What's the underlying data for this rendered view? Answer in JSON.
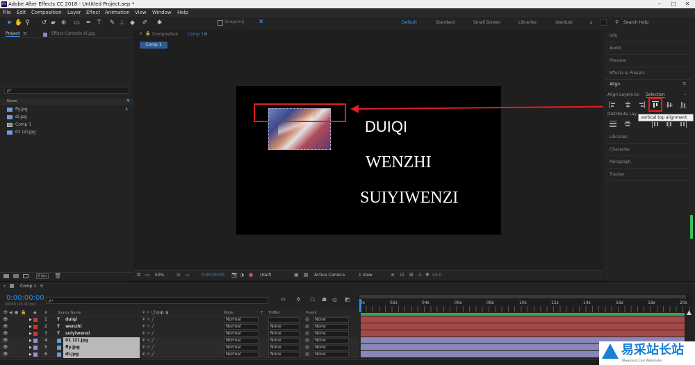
{
  "window": {
    "title": "Adobe After Effects CC 2018 - Untitled Project.aep *",
    "logo": "Ae",
    "minimize": "–",
    "maximize": "□",
    "close": "✕"
  },
  "menu": [
    "File",
    "Edit",
    "Composition",
    "Layer",
    "Effect",
    "Animation",
    "View",
    "Window",
    "Help"
  ],
  "toolbar": {
    "snapping": "Snapping",
    "workspaces": [
      "Default",
      "Standard",
      "Small Screen",
      "Libraries",
      "stardust"
    ],
    "overflow": "»",
    "search": "Search Help"
  },
  "project": {
    "tab": "Project",
    "effect_controls_tab": "Effect Controls di.jpg",
    "search_placeholder": "ρ•",
    "name_col": "Name",
    "items": [
      {
        "icon": "image",
        "name": "fly.jpg"
      },
      {
        "icon": "image",
        "name": "di.jpg"
      },
      {
        "icon": "comp",
        "name": "Comp 1"
      },
      {
        "icon": "image",
        "name": "01 (2).jpg"
      }
    ],
    "bpc": "8 bpc"
  },
  "composition": {
    "tab_prefix": "Composition",
    "tab_name": "Comp 1",
    "sub_tab": "Comp 1",
    "zoom": "50%",
    "timecode": "0:00:00:00",
    "resolution": "(Half)",
    "camera": "Active Camera",
    "views": "1 View",
    "offset": "+0.0",
    "texts": [
      "DUIQI",
      "WENZHI",
      "SUIYIWENZI"
    ]
  },
  "right_panel": {
    "items_top": [
      "Info",
      "Audio",
      "Preview",
      "Effects & Presets"
    ],
    "align_title": "Align",
    "align_layers_to_label": "Align Layers to:",
    "align_layers_to_value": "Selection",
    "distribute_label": "Distribute Lay",
    "tooltip": "vertical top alignment",
    "items_bottom": [
      "Libraries",
      "Character",
      "Paragraph",
      "Tracker"
    ]
  },
  "timeline": {
    "tab": "Comp 1",
    "timecode": "0:00:00:00",
    "frames": "00000 (25.00 fps)",
    "search_placeholder": "ρ•",
    "col_hash": "#",
    "col_source": "Source Name",
    "col_mode": "Mode",
    "col_t": "T",
    "col_trkmat": "TrkMat",
    "col_parent": "Parent",
    "ruler": [
      "0s",
      "02s",
      "04s",
      "06s",
      "08s",
      "10s",
      "12s",
      "14s",
      "16s",
      "18s",
      "20s"
    ],
    "layers": [
      {
        "num": "1",
        "type": "T",
        "name": "duiqi",
        "mode": "Normal",
        "trkmat": "",
        "parent": "None",
        "label_color": "#c23a3a",
        "bar_color": "#a44a4a"
      },
      {
        "num": "2",
        "type": "T",
        "name": "wenzhi",
        "mode": "Normal",
        "trkmat": "None",
        "parent": "None",
        "label_color": "#c23a3a",
        "bar_color": "#a44a4a"
      },
      {
        "num": "3",
        "type": "T",
        "name": "suiyiwenzi",
        "mode": "Normal",
        "trkmat": "None",
        "parent": "None",
        "label_color": "#c23a3a",
        "bar_color": "#a44a4a"
      },
      {
        "num": "4",
        "type": "img",
        "name": "01 (2).jpg",
        "mode": "Normal",
        "trkmat": "None",
        "parent": "None",
        "label_color": "#9a8fc8",
        "bar_color": "#8a86b8"
      },
      {
        "num": "5",
        "type": "img",
        "name": "fly.jpg",
        "mode": "Normal",
        "trkmat": "None",
        "parent": "None",
        "label_color": "#9a8fc8",
        "bar_color": "#8a86b8"
      },
      {
        "num": "6",
        "type": "img",
        "name": "di.jpg",
        "mode": "Normal",
        "trkmat": "None",
        "parent": "None",
        "label_color": "#9a8fc8",
        "bar_color": "#8a86b8"
      }
    ]
  },
  "watermark": {
    "text": "易采站长站",
    "sub": "Www.Easck.Com Webmaster"
  },
  "colors": {
    "accent": "#2d8ceb",
    "highlight_red": "#e0201e",
    "text_bar": "#a44a4a",
    "image_bar": "#8a86b8"
  }
}
